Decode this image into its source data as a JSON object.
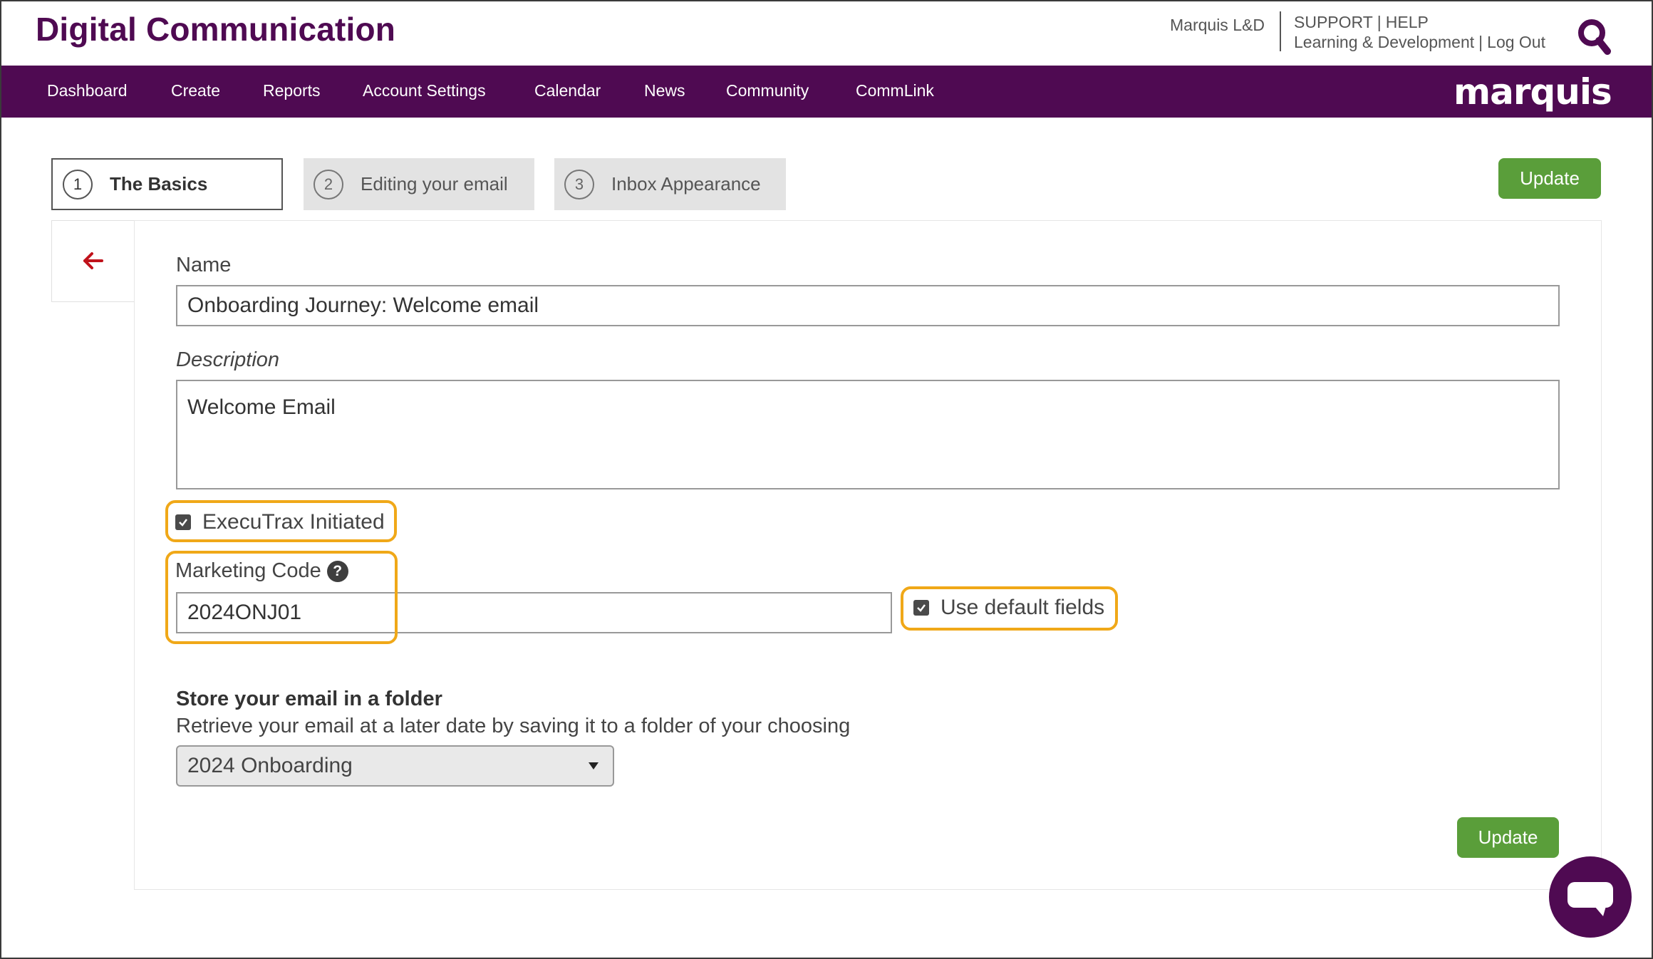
{
  "header": {
    "app_title": "Digital Communication",
    "account_name": "Marquis L&D",
    "support_label": "SUPPORT",
    "help_label": "HELP",
    "org_label": "Learning & Development",
    "logout_label": "Log Out",
    "separator": "|",
    "search_icon": "search-icon"
  },
  "nav": {
    "items": [
      "Dashboard",
      "Create",
      "Reports",
      "Account Settings",
      "Calendar",
      "News",
      "Community",
      "CommLink"
    ],
    "brand": "marquis",
    "background": "#4f0a52"
  },
  "steps": [
    {
      "number": "1",
      "label": "The Basics",
      "active": true
    },
    {
      "number": "2",
      "label": "Editing your email",
      "active": false
    },
    {
      "number": "3",
      "label": "Inbox Appearance",
      "active": false
    }
  ],
  "actions": {
    "update_label": "Update",
    "update_color": "#5a9e3a"
  },
  "form": {
    "back_icon": "arrow-left-icon",
    "name_label": "Name",
    "name_value": "Onboarding Journey: Welcome email",
    "description_label": "Description",
    "description_value": "Welcome Email",
    "executrax_label": "ExecuTrax Initiated",
    "executrax_checked": true,
    "marketing_code_label": "Marketing Code",
    "help_glyph": "?",
    "marketing_code_value": "2024ONJ01",
    "default_fields_label": "Use default fields",
    "default_fields_checked": true,
    "folder_title": "Store your email in a folder",
    "folder_help": "Retrieve your email at a later date by saving it to a folder of your choosing",
    "folder_selected": "2024 Onboarding"
  },
  "highlight_color": "#f0a818",
  "chat_icon": "chat-bubble-icon"
}
